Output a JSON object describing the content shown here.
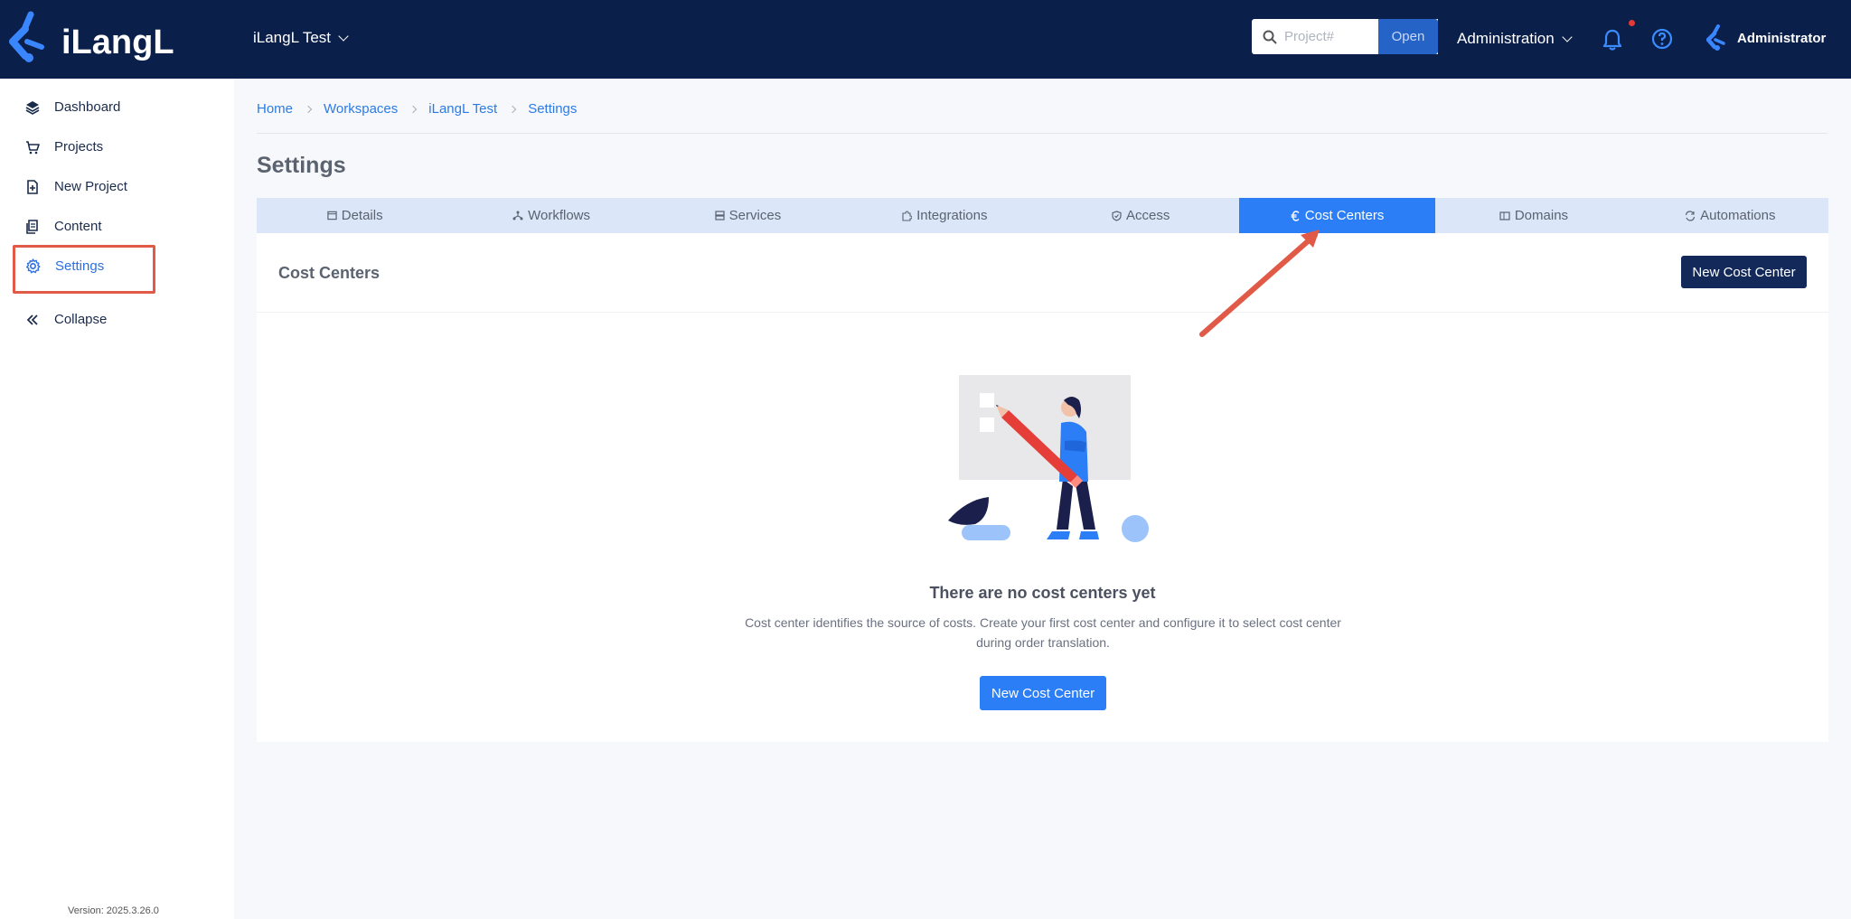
{
  "header": {
    "logo_text": "iLangL",
    "workspace": "iLangL Test",
    "search_placeholder": "Project#",
    "open_label": "Open",
    "admin_menu": "Administration",
    "user_name": "Administrator"
  },
  "sidebar": {
    "items": [
      {
        "label": "Dashboard",
        "icon": "layers-icon"
      },
      {
        "label": "Projects",
        "icon": "cart-icon"
      },
      {
        "label": "New Project",
        "icon": "file-plus-icon"
      },
      {
        "label": "Content",
        "icon": "documents-icon"
      },
      {
        "label": "Settings",
        "icon": "gear-icon"
      },
      {
        "label": "Collapse",
        "icon": "double-chevron-left-icon"
      }
    ],
    "version": "Version: 2025.3.26.0"
  },
  "breadcrumb": [
    "Home",
    "Workspaces",
    "iLangL Test",
    "Settings"
  ],
  "page": {
    "title": "Settings"
  },
  "tabs": [
    {
      "label": "Details",
      "icon": "window-icon"
    },
    {
      "label": "Workflows",
      "icon": "workflow-icon"
    },
    {
      "label": "Services",
      "icon": "server-icon"
    },
    {
      "label": "Integrations",
      "icon": "puzzle-icon"
    },
    {
      "label": "Access",
      "icon": "shield-icon"
    },
    {
      "label": "Cost Centers",
      "icon": "euro-icon"
    },
    {
      "label": "Domains",
      "icon": "building-icon"
    },
    {
      "label": "Automations",
      "icon": "sync-icon"
    }
  ],
  "panel": {
    "title": "Cost Centers",
    "new_button": "New Cost Center",
    "empty_title": "There are no cost centers yet",
    "empty_desc": "Cost center identifies the source of costs. Create your first cost center and configure it to select cost center during order translation.",
    "empty_button": "New Cost Center"
  },
  "colors": {
    "header_bg": "#0b1f4b",
    "accent": "#2b7ef6",
    "annotation": "#e05a47"
  }
}
